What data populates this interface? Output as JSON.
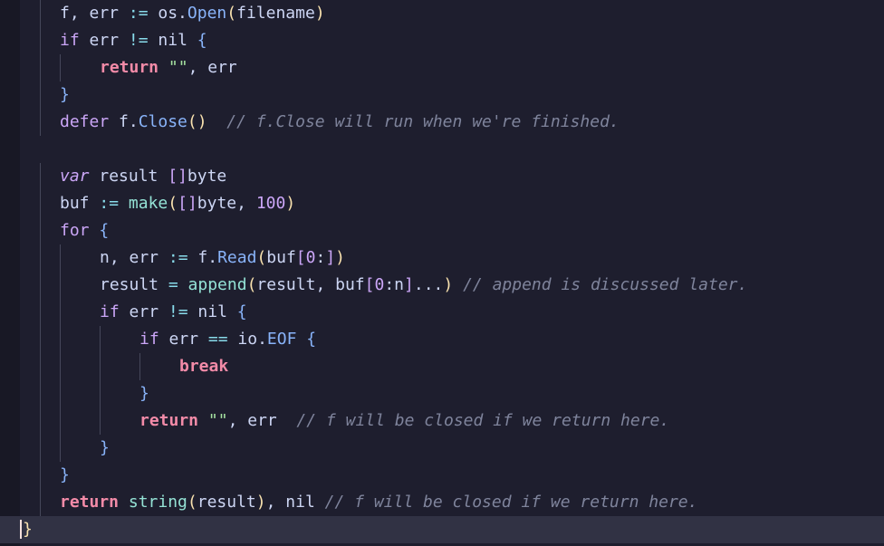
{
  "editor": {
    "language": "go",
    "theme_colors": {
      "background": "#1e1e2e",
      "current_line": "#313244",
      "keyword": "#cba6f7",
      "function": "#89b4fa",
      "string": "#a6e3a1",
      "comment": "#7f849c",
      "text": "#cdd6f4"
    },
    "lines": [
      "f, err := os.Open(filename)",
      "if err != nil {",
      "return \"\", err",
      "}",
      "defer f.Close()  // f.Close will run when we're finished.",
      "",
      "var result []byte",
      "buf := make([]byte, 100)",
      "for {",
      "n, err := f.Read(buf[0:])",
      "result = append(result, buf[0:n]...) // append is discussed later.",
      "if err != nil {",
      "if err == io.EOF {",
      "break",
      "}",
      "return \"\", err  // f will be closed if we return here.",
      "}",
      "}",
      "return string(result), nil // f will be closed if we return here.",
      "}"
    ]
  }
}
